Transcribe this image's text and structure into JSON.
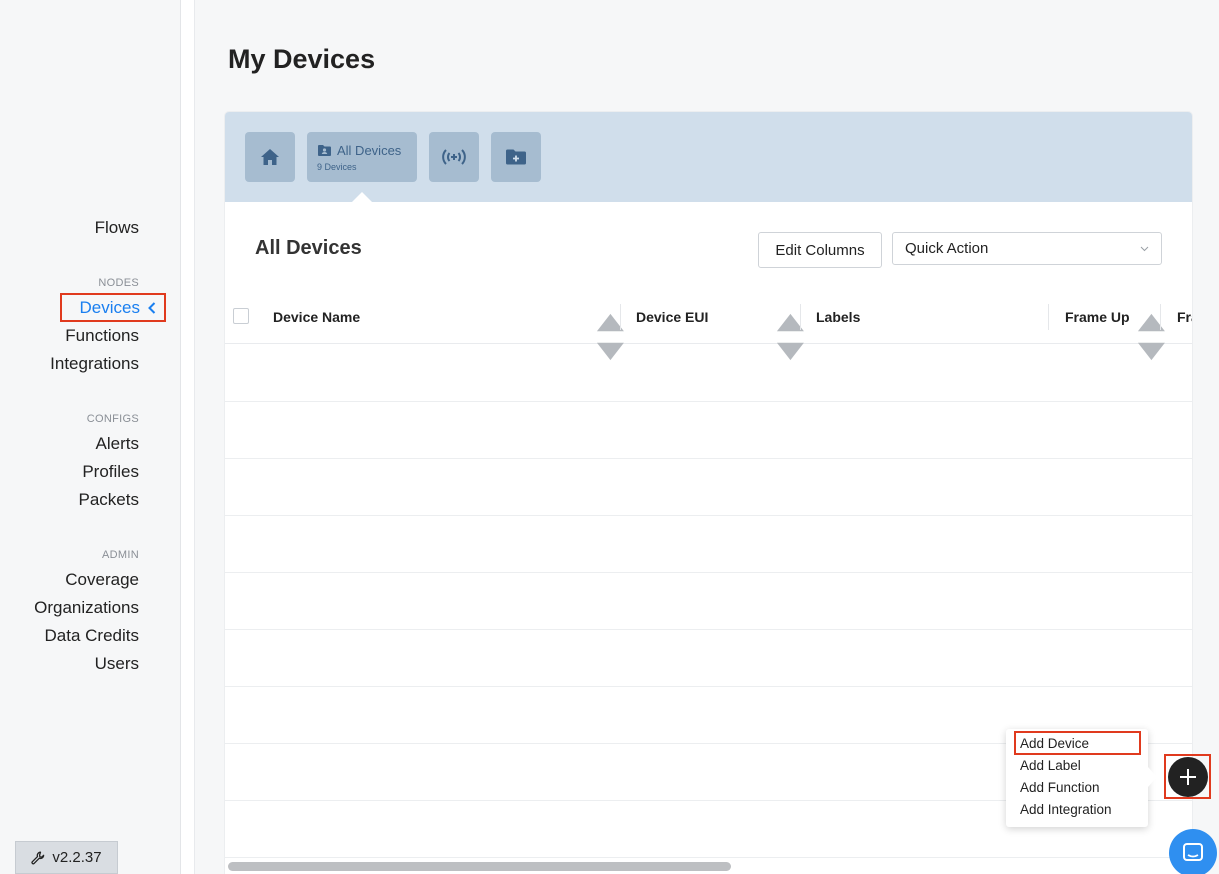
{
  "page": {
    "title": "My Devices"
  },
  "sidebar": {
    "flows": "Flows",
    "sections": {
      "nodes": "NODES",
      "configs": "CONFIGS",
      "admin": "ADMIN"
    },
    "nodes_items": {
      "devices": "Devices",
      "functions": "Functions",
      "integrations": "Integrations"
    },
    "configs_items": {
      "alerts": "Alerts",
      "profiles": "Profiles",
      "packets": "Packets"
    },
    "admin_items": {
      "coverage": "Coverage",
      "organizations": "Organizations",
      "data_credits": "Data Credits",
      "users": "Users"
    },
    "active_item": "Devices",
    "version": "v2.2.37"
  },
  "header_tabs": {
    "all_devices_label": "All Devices",
    "all_devices_count": "9 Devices",
    "icons": [
      "home-icon",
      "folder-user-icon",
      "signal-icon",
      "folder-plus-icon"
    ]
  },
  "table_section": {
    "title": "All Devices",
    "edit_columns": "Edit Columns",
    "quick_action": "Quick Action"
  },
  "table": {
    "columns": [
      "Device Name",
      "Device EUI",
      "Labels",
      "Frame Up",
      "Fra"
    ],
    "rows": [],
    "empty_row_count": 9
  },
  "menu": {
    "items": [
      "Add Device",
      "Add Label",
      "Add Function",
      "Add Integration"
    ]
  },
  "colors": {
    "accent": "#1a7ff0",
    "highlight": "#e03a1e",
    "header_bg": "#d0deeb",
    "tab_bg": "#a6bcd0",
    "fab": "#222222",
    "chat": "#2f8ff0"
  }
}
